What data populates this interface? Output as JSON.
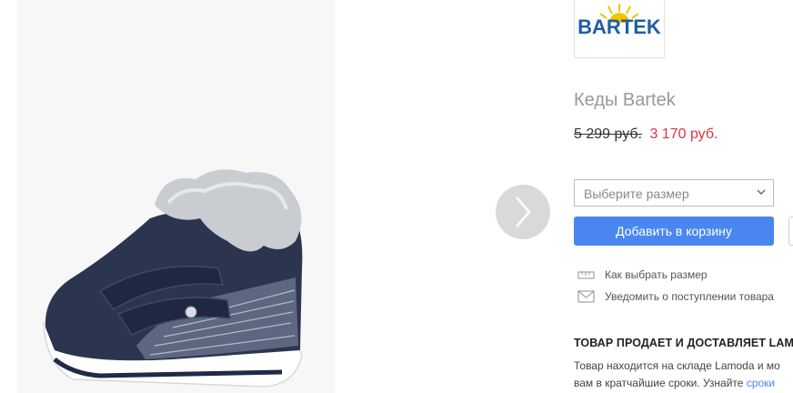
{
  "brand": {
    "name": "BARTEK"
  },
  "product": {
    "title": "Кеды Bartek",
    "price_old": "5 299 руб.",
    "price_new": "3 170 руб."
  },
  "size_select": {
    "placeholder": "Выберите размер"
  },
  "cart_button": {
    "label": "Добавить в корзину"
  },
  "links": {
    "size_guide": "Как выбрать размер",
    "notify": "Уведомить о поступлении товара"
  },
  "seller": {
    "heading": "ТОВАР ПРОДАЕТ И ДОСТАВЛЯЕТ LAM",
    "line1": "Товар находится на складе Lamoda и мо",
    "line2_text": "вам в кратчайшие сроки. Узнайте",
    "line2_link": "сроки"
  },
  "colors": {
    "accent": "#4a86f0",
    "sale_price": "#e0333c",
    "brand_blue": "#1d5fa8",
    "brand_sun": "#f5c400"
  }
}
